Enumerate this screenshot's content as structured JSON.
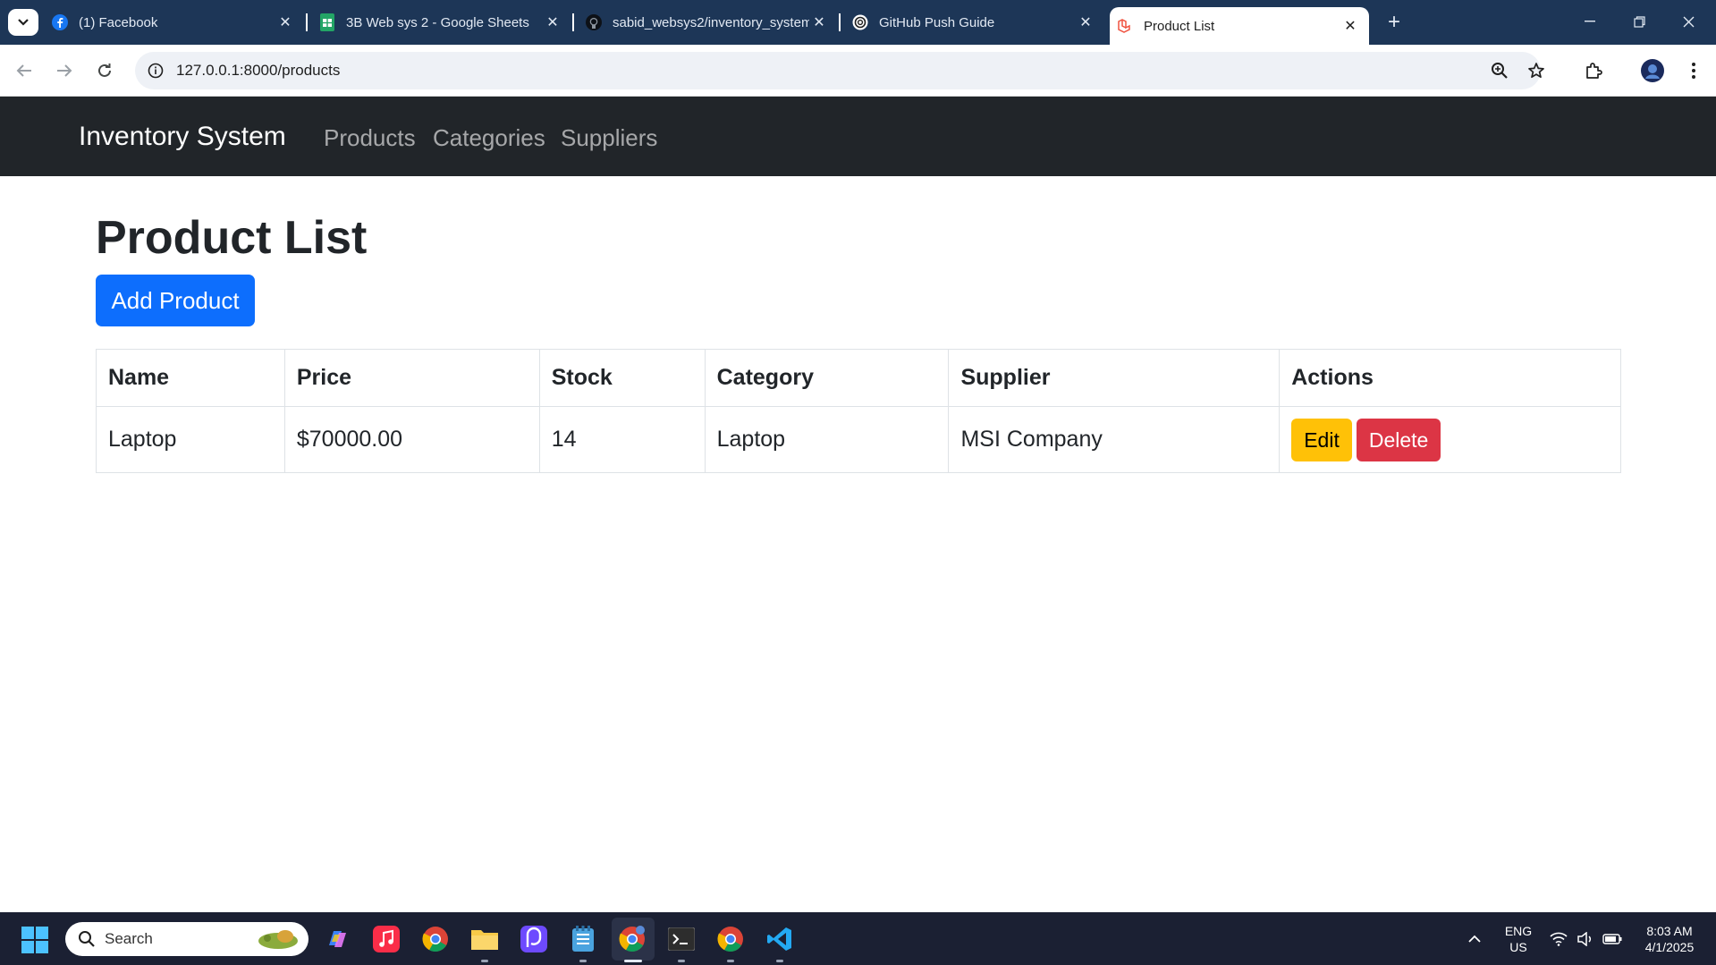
{
  "browser": {
    "tabs": [
      {
        "title": "(1) Facebook",
        "icon": "facebook-icon"
      },
      {
        "title": "3B Web sys 2 - Google Sheets",
        "icon": "google-sheets-icon"
      },
      {
        "title": "sabid_websys2/inventory_system",
        "icon": "github-icon"
      },
      {
        "title": "GitHub Push Guide",
        "icon": "chatgpt-icon"
      },
      {
        "title": "Product List",
        "icon": "laravel-icon"
      }
    ],
    "active_tab": 4,
    "url": "127.0.0.1:8000/products"
  },
  "app": {
    "brand": "Inventory System",
    "nav": [
      "Products",
      "Categories",
      "Suppliers"
    ]
  },
  "page": {
    "title": "Product List",
    "add_button": "Add Product",
    "table": {
      "headers": [
        "Name",
        "Price",
        "Stock",
        "Category",
        "Supplier",
        "Actions"
      ],
      "rows": [
        {
          "name": "Laptop",
          "price": "$70000.00",
          "stock": "14",
          "category": "Laptop",
          "supplier": "MSI Company",
          "edit": "Edit",
          "delete": "Delete"
        }
      ]
    }
  },
  "colors": {
    "navbar": "#212529",
    "primary": "#0d6efd",
    "warning": "#ffc107",
    "danger": "#dc3545"
  },
  "taskbar": {
    "search_placeholder": "Search",
    "language": "ENG",
    "region": "US",
    "time": "8:03 AM",
    "date": "4/1/2025"
  }
}
